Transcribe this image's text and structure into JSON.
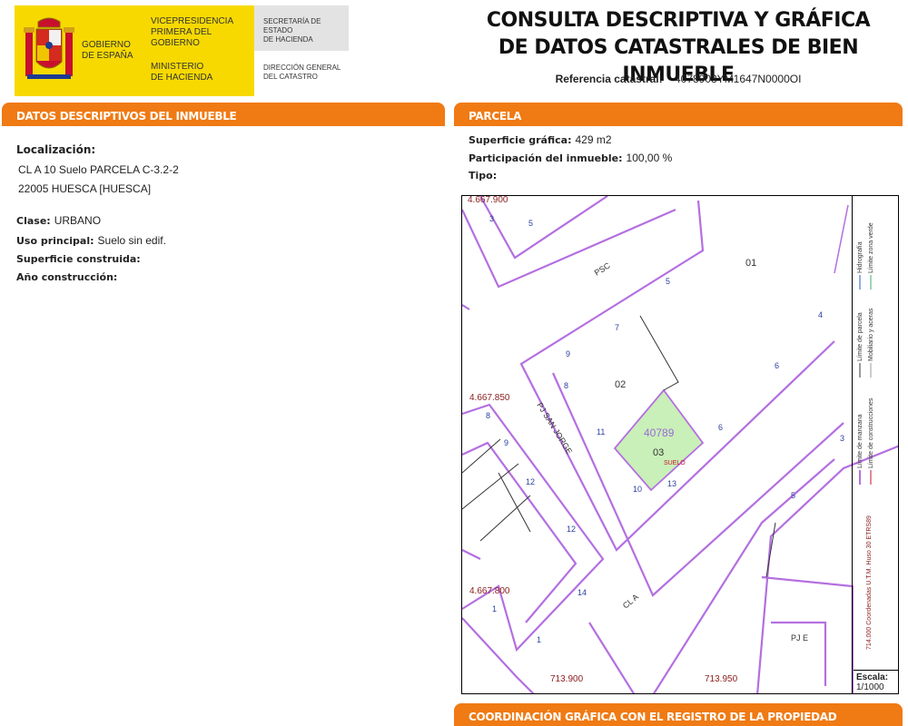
{
  "header": {
    "gov_line1": "GOBIERNO",
    "gov_line2": "DE ESPAÑA",
    "vice_line1": "VICEPRESIDENCIA",
    "vice_line2": "PRIMERA DEL GOBIERNO",
    "min_line1": "MINISTERIO",
    "min_line2": "DE HACIENDA",
    "sec_line1": "SECRETARÍA DE ESTADO",
    "sec_line2": "DE HACIENDA",
    "dir_line1": "DIRECCIÓN GENERAL",
    "dir_line2": "DEL CATASTRO",
    "title_line1": "CONSULTA DESCRIPTIVA Y GRÁFICA",
    "title_line2": "DE DATOS CATASTRALES DE BIEN INMUEBLE",
    "ref_label": "Referencia catastral:",
    "ref_value": "4078903YM1647N0000OI",
    "brand_yellow": "#f7d900",
    "bar_orange": "#f07a13"
  },
  "descriptive": {
    "section_title": "DATOS DESCRIPTIVOS DEL INMUEBLE",
    "localizacion_label": "Localización:",
    "address_line1": "CL A 10 Suelo PARCELA C-3.2-2",
    "address_line2": "22005 HUESCA [HUESCA]",
    "clase_label": "Clase:",
    "clase_value": "URBANO",
    "uso_label": "Uso principal:",
    "uso_value": "Suelo sin edif.",
    "superficie_label": "Superficie construida:",
    "anio_label": "Año construcción:"
  },
  "parcela": {
    "section_title": "PARCELA",
    "sup_label": "Superficie gráfica:",
    "sup_value": "429 m2",
    "part_label": "Participación del inmueble:",
    "part_value": "100,00 %",
    "tipo_label": "Tipo:"
  },
  "map": {
    "coord_top": "4.667.900",
    "coord_mid": "4.667.850",
    "coord_low": "4.667.800",
    "coord_x1": "713.900",
    "coord_x2": "713.950",
    "street_psc": "PSC",
    "street_pj": "PJ SAN JORGE",
    "street_cl": "CL A",
    "street_pje": "PJ E",
    "parcel_01": "01",
    "parcel_02": "02",
    "parcel_03": "03",
    "parcel_id": "40789",
    "parcel_suelo": "SUELO",
    "num_3": "3",
    "num_5a": "5",
    "num_5b": "5",
    "num_4": "4",
    "num_7": "7",
    "num_6a": "6",
    "num_9": "9",
    "num_8a": "8",
    "num_6b": "6",
    "num_8b": "8",
    "num_11": "11",
    "num_9b": "9",
    "num_10": "10",
    "num_13": "13",
    "num_12a": "12",
    "num_12b": "12",
    "num_14": "14",
    "num_1a": "1",
    "num_1b": "1",
    "num_3b": "3",
    "num_5c": "5",
    "legend_manzana": "Límite de manzana",
    "legend_parcela": "Límite de parcela",
    "legend_hidro": "Hidrografía",
    "legend_constr": "Límite de construcciones",
    "legend_mobil": "Mobiliario y aceras",
    "legend_verde": "Límite zona verde",
    "legend_coord": "714.000 Coordenadas U.T.M. Huso 30 ETRS89",
    "scale_label": "Escala:",
    "scale_value": "1/1000",
    "parcel_fill": "#c9f0b8",
    "line_violet": "#b46fe0"
  },
  "bottom": {
    "section_title": "COORDINACIÓN GRÁFICA CON EL REGISTRO DE LA PROPIEDAD"
  }
}
